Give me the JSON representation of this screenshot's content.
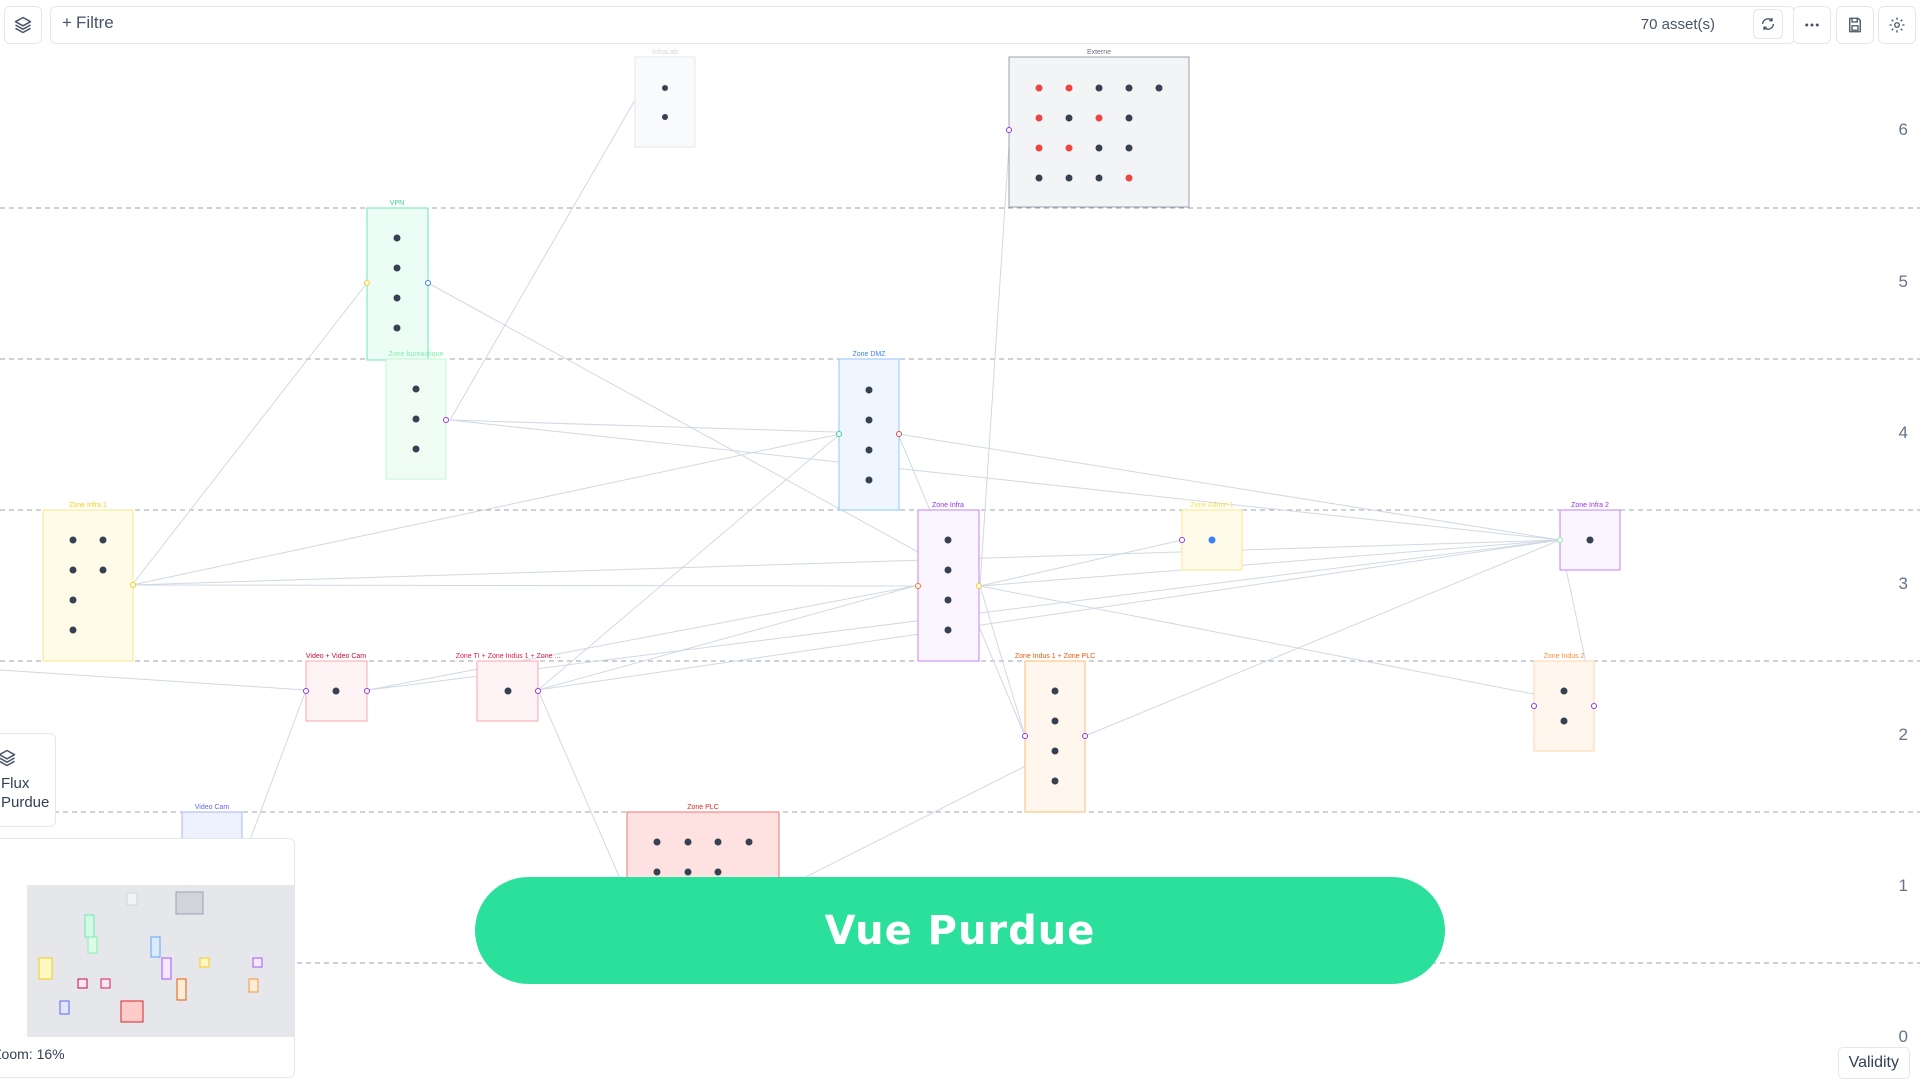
{
  "toolbar": {
    "filter_label": "Filtre",
    "asset_count": "70 asset(s)"
  },
  "levels": [
    "6",
    "5",
    "4",
    "3",
    "2",
    "1",
    "0"
  ],
  "zones": [
    {
      "id": "infralab",
      "name": "InfraLab",
      "color": "#d1d5db"
    },
    {
      "id": "externe",
      "name": "Externe",
      "color": "#6b7280"
    },
    {
      "id": "vpn",
      "name": "VPN",
      "color": "#34d399"
    },
    {
      "id": "zone-bureautique",
      "name": "Zone bureautique",
      "color": "#86efac"
    },
    {
      "id": "zone-dmz",
      "name": "Zone DMZ",
      "color": "#3b82f6"
    },
    {
      "id": "zone-infra-1",
      "name": "Zone Infra 1",
      "color": "#facc15"
    },
    {
      "id": "zone-infra",
      "name": "Zone Infra",
      "color": "#9333ea"
    },
    {
      "id": "zone-admin",
      "name": "Zone Admin 1",
      "color": "#fde047"
    },
    {
      "id": "zone-infra-2",
      "name": "Zone Infra 2",
      "color": "#9333ea"
    },
    {
      "id": "video-cam-group",
      "name": "Video + Video Cam",
      "color": "#be123c"
    },
    {
      "id": "zone-ti-group",
      "name": "Zone TI + Zone Indus 1 + Zone ...",
      "color": "#e11d48"
    },
    {
      "id": "zone-indus-plc",
      "name": "Zone Indus 1 + Zone PLC",
      "color": "#ea580c"
    },
    {
      "id": "zone-indus-2",
      "name": "Zone Indus 2",
      "color": "#fb923c"
    },
    {
      "id": "video-cam",
      "name": "Video Cam",
      "color": "#6366f1"
    },
    {
      "id": "zone-plc",
      "name": "Zone PLC",
      "color": "#dc2626"
    }
  ],
  "legend": {
    "text": "Flux\nPurdue"
  },
  "minimap": {
    "zoom_label": "Zoom: ",
    "zoom_value": "16%"
  },
  "banner": {
    "title": "Vue Purdue"
  },
  "validity": {
    "label": "Validity"
  }
}
